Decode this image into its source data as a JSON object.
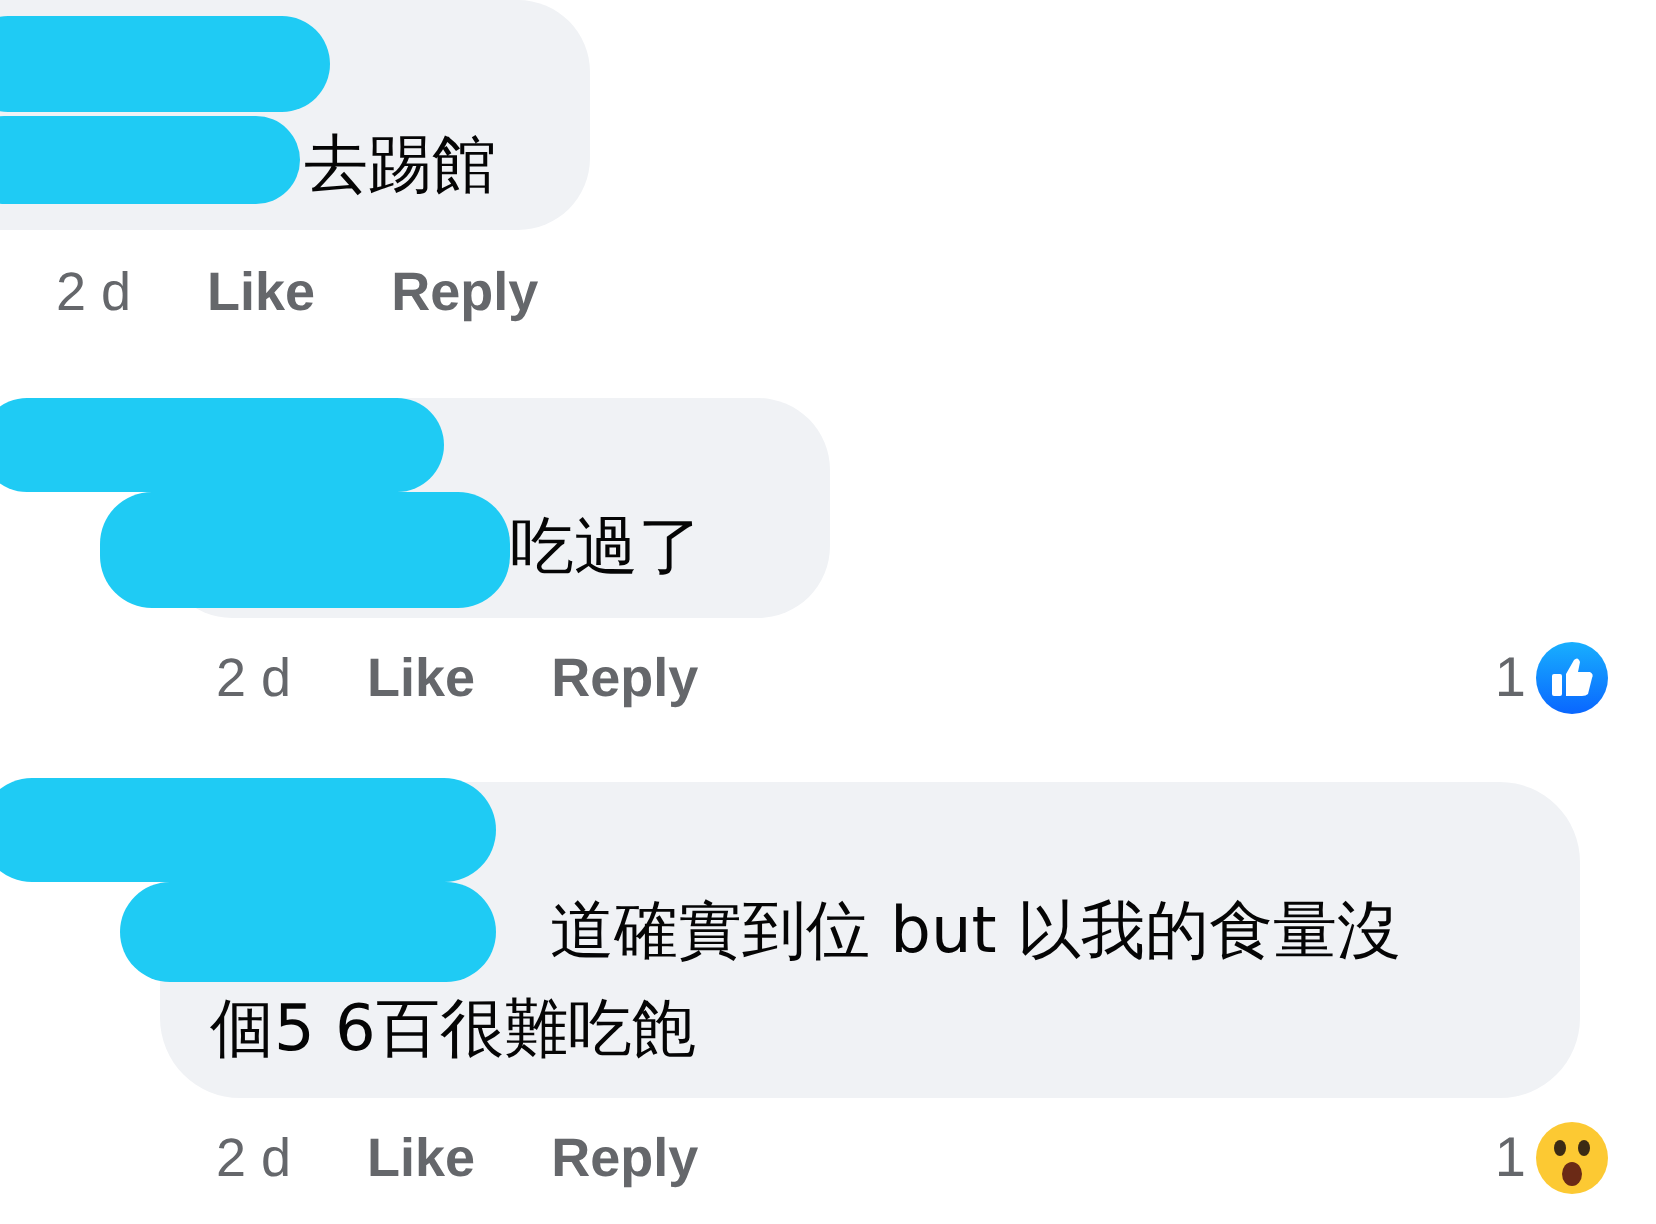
{
  "comments": [
    {
      "text": "去踢館",
      "time": "2 d",
      "actions": [
        "Like",
        "Reply"
      ]
    },
    {
      "text": "吃過了",
      "time": "2 d",
      "actions": [
        "Like",
        "Reply"
      ],
      "reaction": {
        "count": "1",
        "kind": "like"
      }
    },
    {
      "lines": [
        "道確實到位 but 以我的食量沒",
        "個5 6百很難吃飽"
      ],
      "time": "2 d",
      "actions": [
        "Like",
        "Reply"
      ],
      "reaction": {
        "count": "1",
        "kind": "wow"
      }
    }
  ]
}
